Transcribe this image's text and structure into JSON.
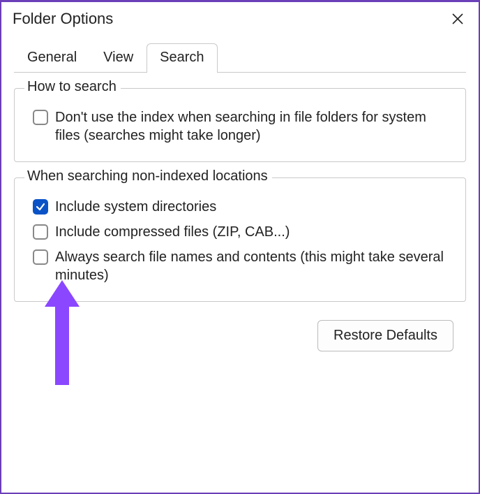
{
  "window": {
    "title": "Folder Options"
  },
  "tabs": {
    "items": [
      {
        "label": "General"
      },
      {
        "label": "View"
      },
      {
        "label": "Search"
      }
    ],
    "active_index": 2
  },
  "group_how": {
    "legend": "How to search",
    "options": [
      {
        "label": "Don't use the index when searching in file folders for system files (searches might take longer)",
        "checked": false
      }
    ]
  },
  "group_nonindexed": {
    "legend": "When searching non-indexed locations",
    "options": [
      {
        "label": "Include system directories",
        "checked": true
      },
      {
        "label": "Include compressed files (ZIP, CAB...)",
        "checked": false
      },
      {
        "label": "Always search file names and contents (this might take several minutes)",
        "checked": false
      }
    ]
  },
  "buttons": {
    "restore_defaults": "Restore Defaults"
  },
  "colors": {
    "accent_border": "#6b3fb8",
    "checkbox_checked": "#0a53c7",
    "annotation_arrow": "#8a47ff"
  }
}
